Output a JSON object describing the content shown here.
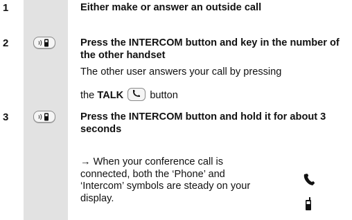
{
  "steps": [
    {
      "number": "1",
      "text": "Either make or answer an outside call"
    },
    {
      "number": "2",
      "text": "Press the INTERCOM button and key in the number of the other handset"
    },
    {
      "number": "3",
      "text": "Press the INTERCOM button and hold it for about 3 seconds"
    }
  ],
  "step2_note": {
    "line1": "The other user answers your call by pressing",
    "prefix": "the",
    "talk_label": "TALK",
    "suffix": "button"
  },
  "step3_note": {
    "arrow": "→",
    "text": "When your conference call is connected, both the ‘Phone’ and ‘Intercom’ symbols are steady on your display."
  },
  "icons": {
    "intercom_button": "intercom-button-icon",
    "talk_button": "talk-button-icon",
    "phone_symbol": "phone-symbol-icon",
    "intercom_symbol": "handset-symbol-icon"
  }
}
